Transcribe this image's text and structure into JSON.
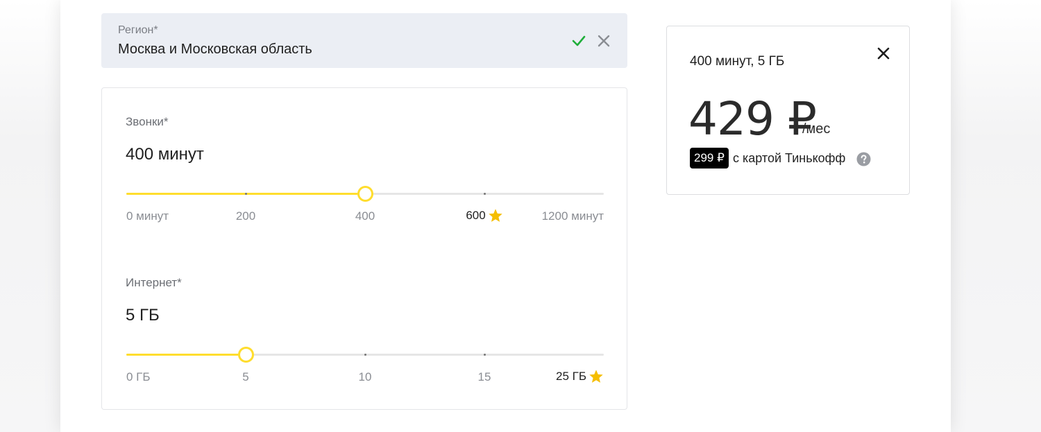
{
  "region": {
    "label": "Регион*",
    "value": "Москва и Московская область",
    "check_icon": "check-icon",
    "clear_icon": "close-icon"
  },
  "calls": {
    "label": "Звонки*",
    "value": "400 минут",
    "selected_index": 2,
    "ticks": [
      "0 минут",
      "200",
      "400",
      "600",
      "1200 минут"
    ],
    "star_tick_index": 3
  },
  "internet": {
    "label": "Интернет*",
    "value": "5 ГБ",
    "selected_index": 1,
    "ticks": [
      "0 ГБ",
      "5",
      "10",
      "15",
      "25 ГБ"
    ],
    "star_tick_index": 4
  },
  "summary": {
    "title": "400 минут, 5 ГБ",
    "price": "429 ₽",
    "per": "/мес",
    "promo_price": "299 ₽",
    "promo_text": "с картой Тинькофф"
  },
  "colors": {
    "accent_yellow": "#ffdd2d",
    "star": "#f5be00",
    "check_green": "#1fae3a",
    "region_bg": "#ebeef4"
  }
}
